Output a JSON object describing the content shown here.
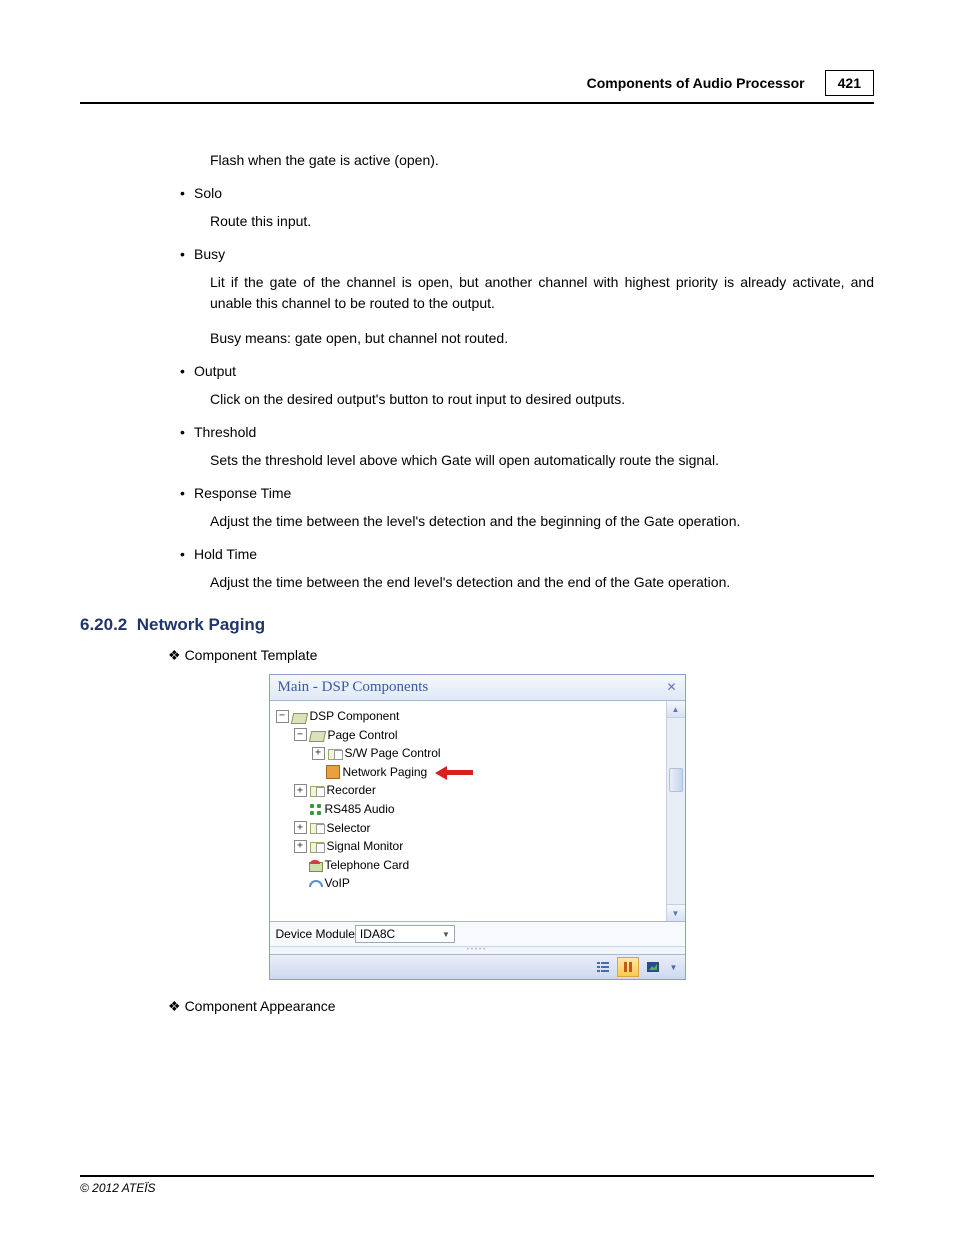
{
  "header": {
    "title": "Components of Audio Processor",
    "page": "421"
  },
  "body": {
    "flashDesc": "Flash when the gate is active (open).",
    "solo": {
      "label": "Solo",
      "desc": "Route this input."
    },
    "busy": {
      "label": "Busy",
      "desc1": "Lit if the gate of the channel is open, but another channel with highest priority is already activate, and unable this channel to be routed to the output.",
      "desc2": "Busy means: gate open, but channel not routed."
    },
    "output": {
      "label": "Output",
      "desc": "Click on the desired output's button to rout input to desired outputs."
    },
    "threshold": {
      "label": "Threshold",
      "desc": "Sets the threshold level above which Gate will open automatically route the signal."
    },
    "responseTime": {
      "label": "Response Time",
      "desc": "Adjust the time between the level's detection and the beginning of the Gate operation."
    },
    "holdTime": {
      "label": "Hold Time",
      "desc": "Adjust the time between the end level's detection and the end of the Gate operation."
    }
  },
  "section": {
    "number": "6.20.2",
    "title": "Network Paging"
  },
  "labels": {
    "componentTemplate": "Component Template",
    "componentAppearance": "Component Appearance"
  },
  "panel": {
    "title": "Main - DSP Components",
    "tree": {
      "root": "DSP Component",
      "pageControl": "Page Control",
      "swPageControl": "S/W Page Control",
      "networkPaging": "Network Paging",
      "recorder": "Recorder",
      "rs485": "RS485 Audio",
      "selector": "Selector",
      "signalMonitor": "Signal Monitor",
      "telephoneCard": "Telephone Card",
      "voip": "VoIP"
    },
    "deviceModuleLabel": "Device Module",
    "deviceModuleValue": "IDA8C"
  },
  "footer": {
    "copyright": "© 2012 ATEÏS"
  }
}
